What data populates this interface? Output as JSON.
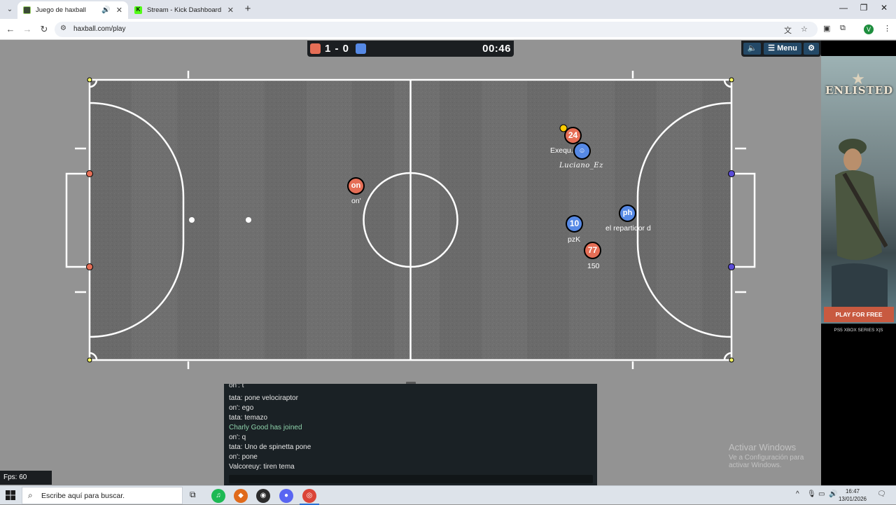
{
  "browser": {
    "tabs": [
      {
        "title": "Juego de haxball",
        "active": true
      },
      {
        "title": "Stream - Kick Dashboard",
        "active": false
      }
    ],
    "url": "haxball.com/play",
    "profile_initial": "V"
  },
  "game": {
    "score": "1 - 0",
    "time": "00:46",
    "menu_label": "Menu",
    "players": [
      {
        "number": "24",
        "team": "red",
        "name": "Exequ...re"
      },
      {
        "number": "",
        "team": "blue",
        "name": "Luciano_Ez"
      },
      {
        "number": "on",
        "team": "red",
        "name": "on'"
      },
      {
        "number": "ph",
        "team": "blue",
        "name": "el repartidor d"
      },
      {
        "number": "10",
        "team": "blue",
        "name": "pzK"
      },
      {
        "number": "77",
        "team": "red",
        "name": "150"
      }
    ],
    "chat": [
      "on': t",
      "tata: pone velociraptor",
      "on': ego",
      "tata: temazo",
      "Charly Good has joined",
      "on': q",
      "tata: Uno de spinetta pone",
      "on': pone",
      "Valcoreuy: tiren tema"
    ],
    "fps": "Fps: 60",
    "colors": {
      "red_team": "#e56e56",
      "blue_team": "#5689e5",
      "ball": "#ffcc00"
    }
  },
  "ad": {
    "logo": "ENLISTED",
    "cta": "PLAY FOR FREE",
    "platforms": "PS5  XBOX SERIES X|S"
  },
  "watermark": {
    "line1": "Activar Windows",
    "line2": "Ve a Configuración para activar Windows."
  },
  "taskbar": {
    "search_placeholder": "Escribe aquí para buscar.",
    "time": "16:47",
    "date": "13/01/2026"
  }
}
